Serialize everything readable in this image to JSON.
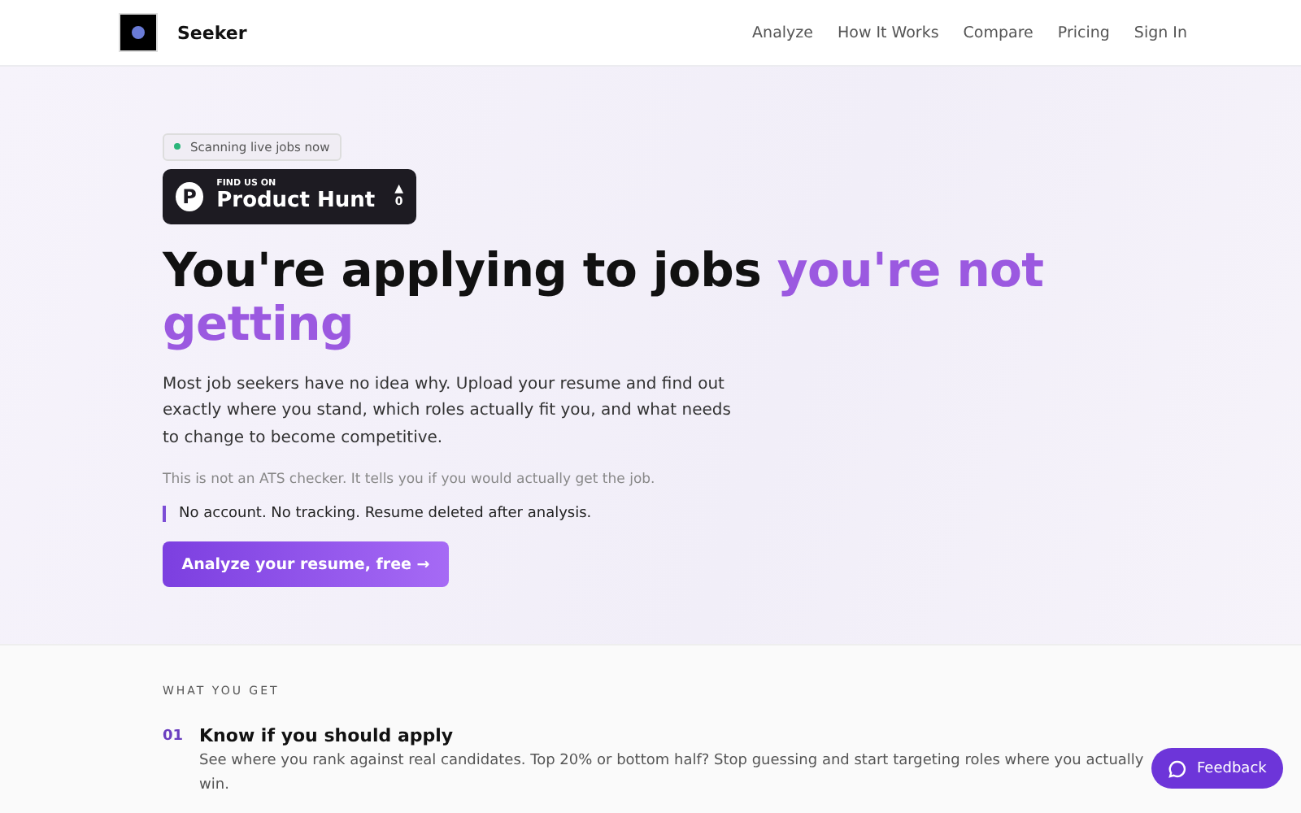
{
  "header": {
    "brand": "Seeker",
    "nav": [
      "Analyze",
      "How It Works",
      "Compare",
      "Pricing",
      "Sign In"
    ]
  },
  "hero": {
    "status_badge": "Scanning live jobs now",
    "product_hunt": {
      "small": "FIND US ON",
      "big": "Product Hunt",
      "letter": "P",
      "upvote_arrow": "▲",
      "count": "0"
    },
    "headline": "You're applying to jobs",
    "headline_accent": "you're not getting",
    "lead": "Most job seekers have no idea why. Upload your resume and find out exactly where you stand, which roles actually fit you, and what needs to change to become competitive.",
    "note": "This is not an ATS checker. It tells you if you would actually get the job.",
    "privacy": "No account. No tracking. Resume deleted after analysis.",
    "cta": "Analyze your resume, free",
    "cta_arrow": "→"
  },
  "features": {
    "eyebrow": "WHAT YOU GET",
    "items": [
      {
        "number": "01",
        "title": "Know if you should apply",
        "text": "See where you rank against real candidates. Top 20% or bottom half? Stop guessing and start targeting roles where you actually win."
      }
    ]
  },
  "feedback_button": "Feedback"
}
